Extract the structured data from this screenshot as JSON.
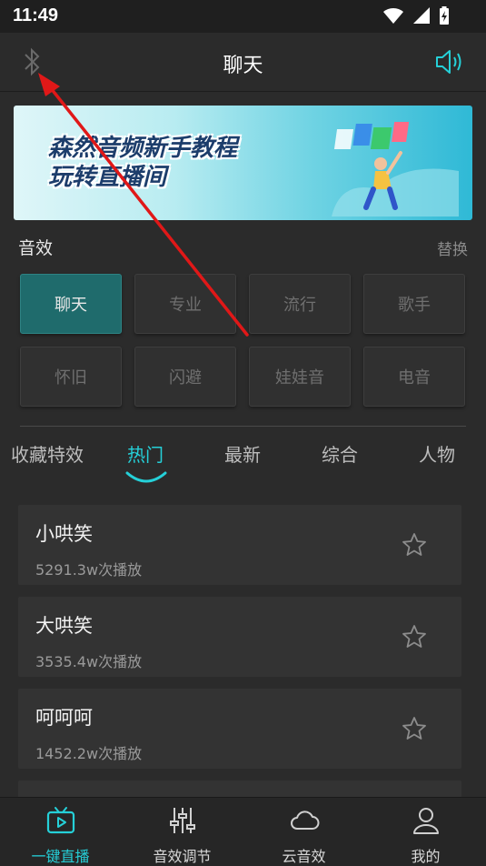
{
  "status_bar": {
    "time": "11:49"
  },
  "header": {
    "title": "聊天",
    "bluetooth_icon": "bluetooth-icon",
    "speaker_icon": "speaker-icon"
  },
  "banner": {
    "line1": "森然音频新手教程",
    "line2": "玩转直播间"
  },
  "effects_section": {
    "label": "音效",
    "switch_label": "替换",
    "buttons": [
      "聊天",
      "专业",
      "流行",
      "歌手",
      "怀旧",
      "闪避",
      "娃娃音",
      "电音"
    ],
    "active_index": 0
  },
  "tabs": [
    "收藏特效",
    "热门",
    "最新",
    "综合",
    "人物"
  ],
  "active_tab": 1,
  "songs": [
    {
      "title": "小哄笑",
      "plays": "5291.3w次播放"
    },
    {
      "title": "大哄笑",
      "plays": "3535.4w次播放"
    },
    {
      "title": "呵呵呵",
      "plays": "1452.2w次播放"
    }
  ],
  "bottom_nav": [
    {
      "label": "一键直播",
      "icon": "tv-play-icon"
    },
    {
      "label": "音效调节",
      "icon": "equalizer-icon"
    },
    {
      "label": "云音效",
      "icon": "cloud-icon"
    },
    {
      "label": "我的",
      "icon": "user-icon"
    }
  ],
  "colors": {
    "accent": "#25d0d8",
    "annotation": "#e01818"
  }
}
